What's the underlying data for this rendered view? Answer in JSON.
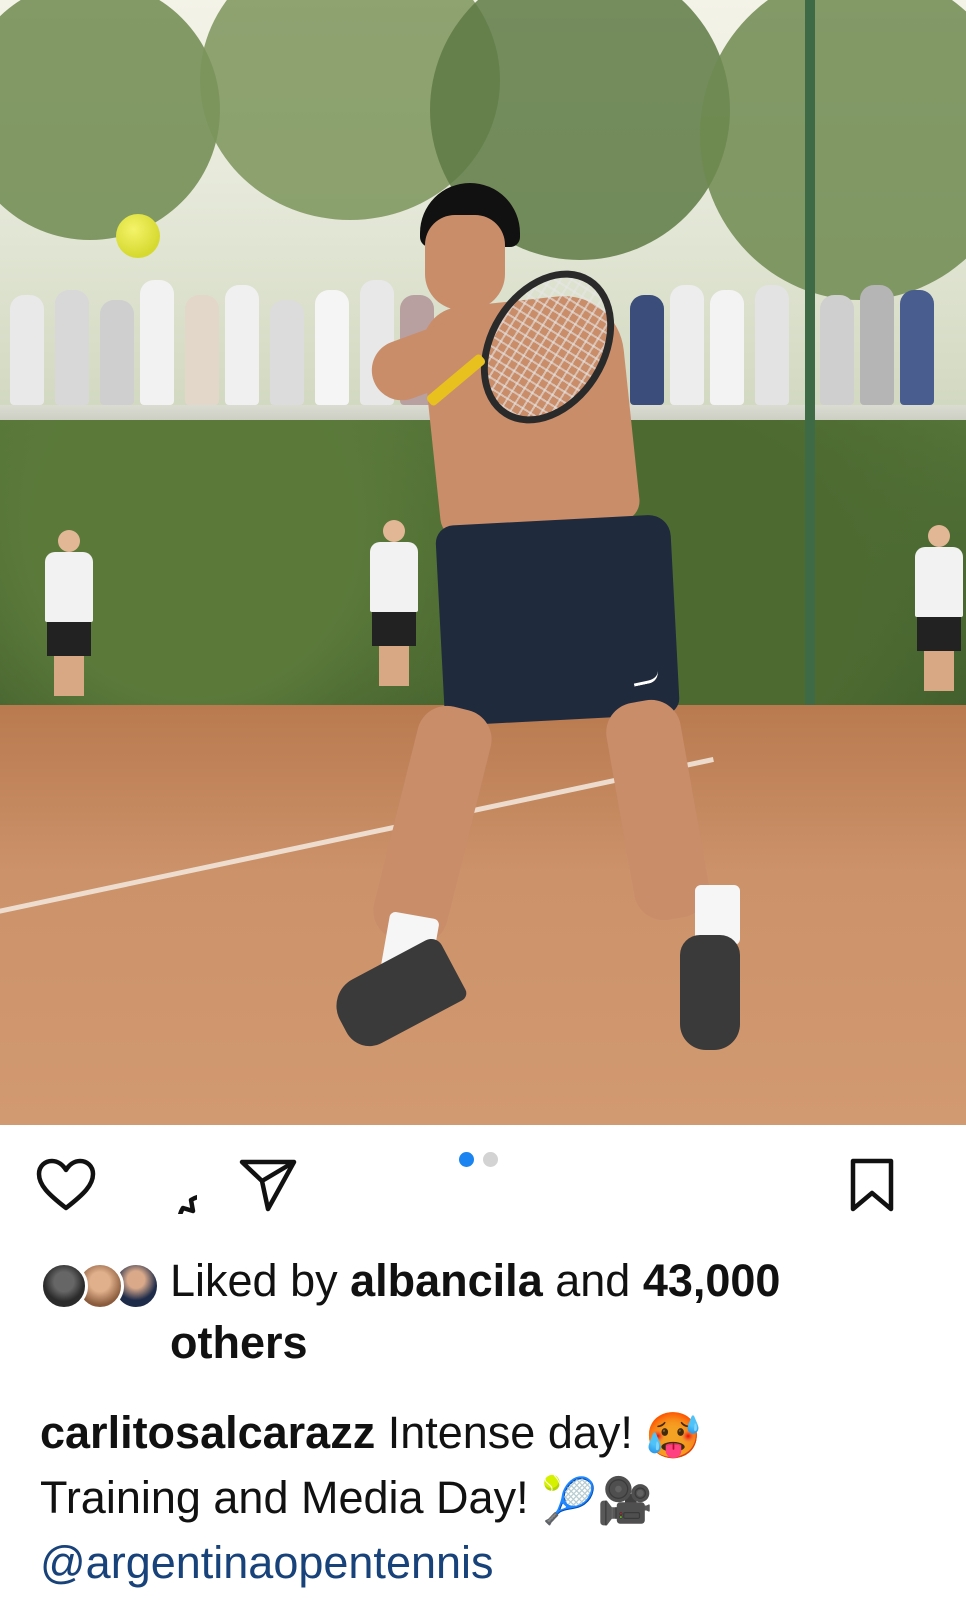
{
  "post": {
    "image_alt": "Tennis player hitting a backhand on a clay court",
    "carousel": {
      "count": 2,
      "active_index": 0
    }
  },
  "actions": {
    "like_icon": "heart-icon",
    "comment_icon": "comment-icon",
    "share_icon": "send-icon",
    "save_icon": "bookmark-icon"
  },
  "likes": {
    "prefix": "Liked by ",
    "user": "albancila",
    "middle": " and ",
    "count": "43,000",
    "suffix": "others"
  },
  "caption": {
    "username": "carlitosalcarazz",
    "line1": "Intense day!",
    "emoji1": "🥵",
    "line2": "Training and Media Day!",
    "emoji2": "🎾",
    "emoji3": "🎥",
    "mention": "@argentinaopentennis"
  },
  "colors": {
    "accent_dot": "#1a84f0",
    "mention": "#18427a",
    "text": "#111111"
  }
}
